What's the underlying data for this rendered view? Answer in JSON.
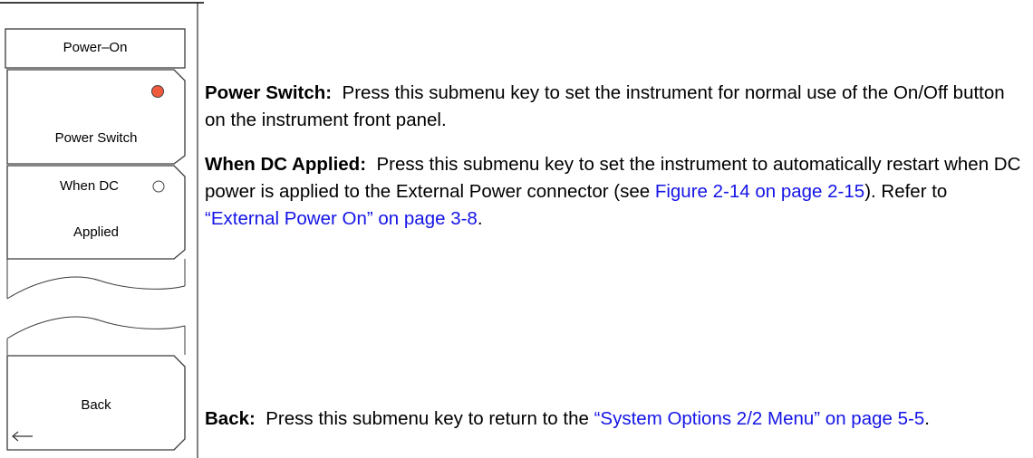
{
  "menu": {
    "title": "Power–On",
    "keys": [
      {
        "label": "Power Switch",
        "selected": true,
        "indicator": "radio-filled"
      },
      {
        "label_line1": "When DC",
        "label_line2": "Applied",
        "selected": false,
        "indicator": "radio-empty"
      },
      {
        "label": "Back",
        "icon": "back-arrow-icon"
      }
    ]
  },
  "colors": {
    "selected_indicator": "#f05a3c",
    "link": "#1414e6",
    "key_border": "#3a3a3a"
  },
  "descriptions": {
    "power_switch": {
      "term": "Power Switch:",
      "text": "Press this submenu key to set the instrument for normal use of the On/Off button on the instrument front panel."
    },
    "when_dc_applied": {
      "term": "When DC Applied:",
      "text_before": "Press this submenu key to set the instrument to automatically restart when DC power is applied to the External Power connector (see ",
      "link1": "Figure 2-14 on page 2-15",
      "text_middle": "). Refer to ",
      "link2": "“External Power On” on page 3-8",
      "text_end": "."
    },
    "back": {
      "term": "Back:",
      "text_before": "Press this submenu key to return to the ",
      "link": "“System Options 2/2 Menu” on page 5-5",
      "text_end": "."
    }
  }
}
